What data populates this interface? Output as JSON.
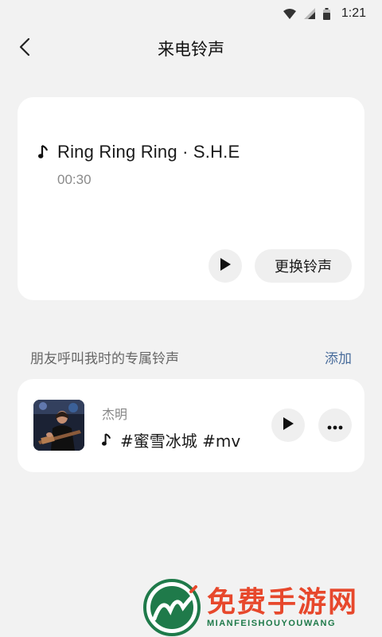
{
  "status_bar": {
    "time": "1:21",
    "icons": [
      "wifi-icon",
      "signal-icon",
      "battery-icon"
    ]
  },
  "header": {
    "title": "来电铃声",
    "back_icon": "chevron-left-icon"
  },
  "current_ringtone": {
    "title": "Ring Ring Ring · S.H.E",
    "duration": "00:30",
    "change_label": "更换铃声",
    "note_icon": "music-note-icon",
    "play_icon": "play-icon"
  },
  "friends_section": {
    "label": "朋友呼叫我时的专属铃声",
    "add_label": "添加",
    "add_color": "#4a6d9c"
  },
  "friend_item": {
    "name": "杰明",
    "song": "#蜜雪冰城 #mv",
    "more_icon": "more-horizontal-icon"
  },
  "watermark": {
    "title": "免费手游网",
    "subtitle": "MIANFEISHOUYOUWANG"
  }
}
